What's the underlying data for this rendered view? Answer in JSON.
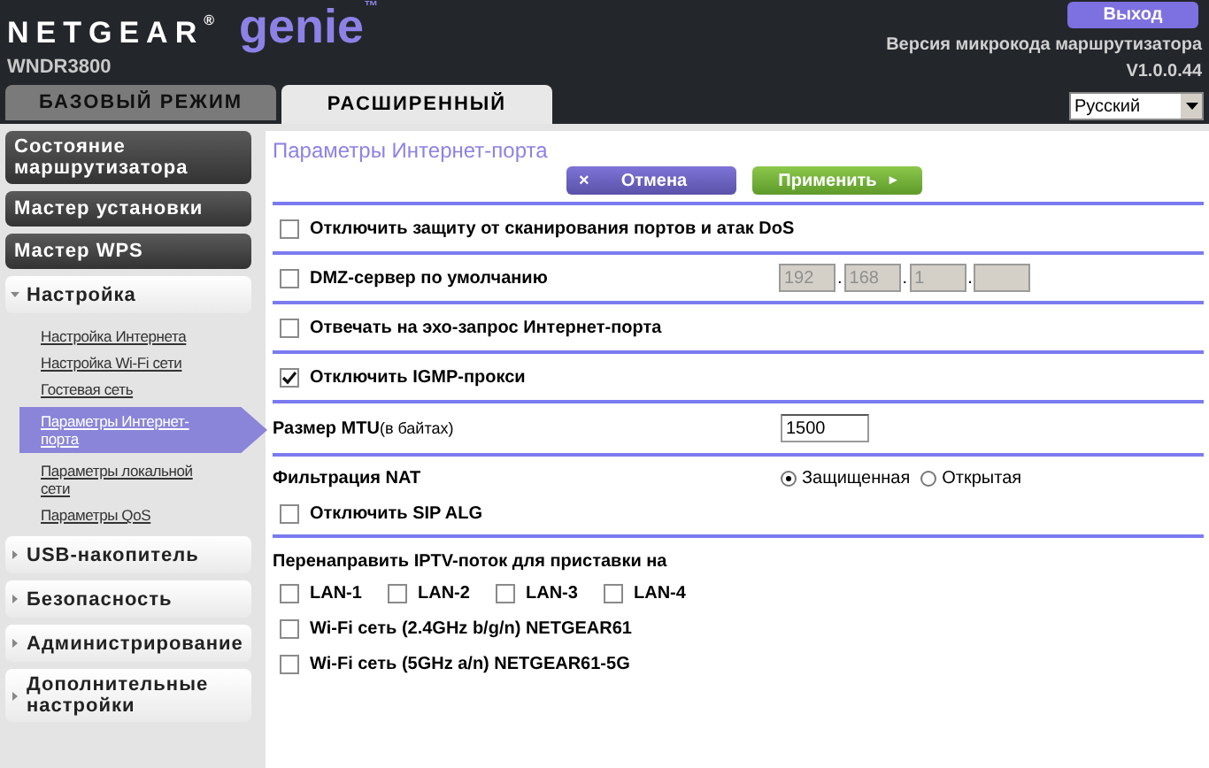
{
  "header": {
    "brand": "NETGEAR$^{®}$",
    "product": "genie$^{™}$",
    "model": "WNDR3800",
    "logout": "Выход",
    "firmware_label": "Версия микрокода маршрутизатора",
    "firmware_version": "V1.0.0.44"
  },
  "tabs": [
    {
      "label": "БАЗОВЫЙ РЕЖИМ",
      "selected": false
    },
    {
      "label": "РАСШИРЕННЫЙ",
      "selected": true
    }
  ],
  "language": {
    "value": "Русский"
  },
  "sidebar": {
    "items": [
      {
        "kind": "button",
        "label": "Состояние маршрутизатора"
      },
      {
        "kind": "button",
        "label": "Мастер установки"
      },
      {
        "kind": "button",
        "label": "Мастер WPS"
      },
      {
        "kind": "section",
        "label": "Настройка",
        "expanded": true,
        "children": [
          {
            "label": "Настройка Интернета",
            "selected": false
          },
          {
            "label": "Настройка Wi-Fi сети",
            "selected": false
          },
          {
            "label": "Гостевая сеть",
            "selected": false
          },
          {
            "label": "Параметры Интернет-порта",
            "selected": true
          },
          {
            "label": "Параметры локальной сети",
            "selected": false
          },
          {
            "label": "Параметры QoS",
            "selected": false
          }
        ]
      },
      {
        "kind": "section",
        "label": "USB-накопитель",
        "expanded": false
      },
      {
        "kind": "section",
        "label": "Безопасность",
        "expanded": false
      },
      {
        "kind": "section",
        "label": "Администрирование",
        "expanded": false
      },
      {
        "kind": "section",
        "label": "Дополнительные настройки",
        "expanded": false
      }
    ]
  },
  "page": {
    "title": "Параметры Интернет-порта",
    "cancel": "Отмена",
    "cancel_icon": "×",
    "apply": "Применить",
    "apply_icon": "▸",
    "sections": [
      {
        "kind": "checkbox",
        "label": "Отключить защиту от сканирования портов и атак DoS",
        "checked": false
      },
      {
        "kind": "ip",
        "label": "DMZ-сервер по умолчанию",
        "checked": false,
        "disabled": true,
        "separator": ".",
        "fields": [
          {
            "kind": "octet",
            "value": "192"
          },
          {
            "kind": "octet",
            "value": "168"
          },
          {
            "kind": "octet",
            "value": "1"
          },
          {
            "kind": "octet"
          }
        ]
      },
      {
        "kind": "checkbox",
        "label": "Отвечать на эхо-запрос Интернет-порта",
        "checked": false
      },
      {
        "kind": "checkbox",
        "label": "Отключить IGMP-прокси",
        "checked": true
      },
      {
        "kind": "input",
        "label": "Размер MTU",
        "note": "(в байтах)",
        "value": "1500"
      },
      {
        "kind": "radio",
        "label": "Фильтрация NAT",
        "options": [
          {
            "label": "Защищенная",
            "selected": true
          },
          {
            "label": "Открытая",
            "selected": false
          }
        ],
        "sub": {
          "label": "Отключить SIP ALG",
          "checked": false
        }
      },
      {
        "kind": "group",
        "label": "Перенаправить IPTV-поток для приставки на",
        "inline": [
          {
            "label": "LAN-1",
            "checked": false
          },
          {
            "label": "LAN-2",
            "checked": false
          },
          {
            "label": "LAN-3",
            "checked": false
          },
          {
            "label": "LAN-4",
            "checked": false
          }
        ],
        "stacked": [
          {
            "label": "Wi-Fi сеть (2.4GHz b/g/n) NETGEAR61",
            "checked": false
          },
          {
            "label": "Wi-Fi сеть (5GHz a/n) NETGEAR61-5G",
            "checked": false
          }
        ]
      }
    ]
  }
}
